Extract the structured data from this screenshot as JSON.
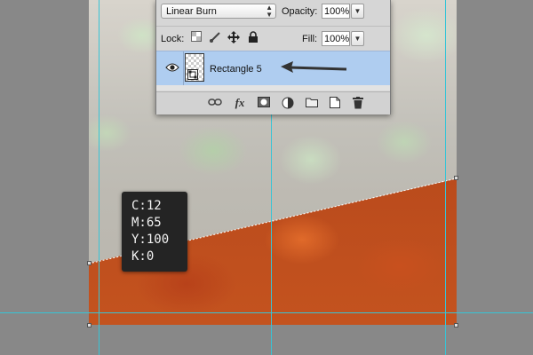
{
  "layers_panel": {
    "blend_mode": "Linear Burn",
    "opacity_label": "Opacity:",
    "opacity_value": "100%",
    "lock_label": "Lock:",
    "fill_label": "Fill:",
    "fill_value": "100%",
    "layer_name": "Rectangle 5",
    "lock_icons": [
      "lock-transparent-icon",
      "lock-brush-icon",
      "lock-move-icon",
      "lock-all-icon"
    ],
    "footer_icons": [
      "link-icon",
      "fx-icon",
      "mask-icon",
      "adjustment-icon",
      "group-folder-icon",
      "new-layer-icon",
      "trash-icon"
    ]
  },
  "cmyk_readout": {
    "c": "C:12",
    "m": "M:65",
    "y": "Y:100",
    "k": "K:0"
  },
  "colors": {
    "guide": "#37c4d6",
    "selected_layer": "#afcdf0",
    "orange_fill": "#c4531f",
    "tooltip_bg": "#242424"
  }
}
